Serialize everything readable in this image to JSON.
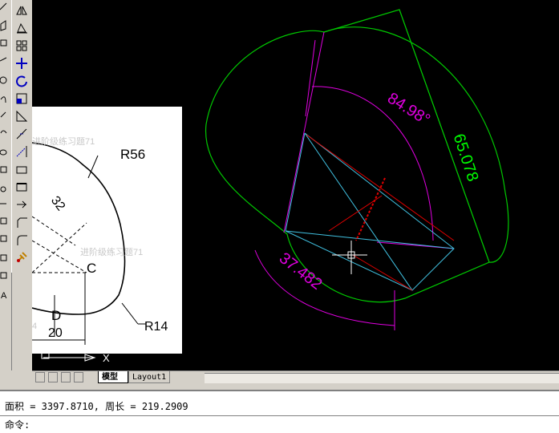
{
  "tabs": {
    "model": "模型",
    "layout1": "Layout1"
  },
  "command": {
    "history_line": "面积 = 3397.8710, 周长 = 219.2909",
    "prompt": "命令:"
  },
  "reference_image": {
    "watermark_top": "进阶级练习题71",
    "watermark_mid": "进阶级练习题71",
    "radius_large": "R56",
    "radius_small": "R14",
    "dim_32": "32",
    "dim_20": "20",
    "point_c": "C",
    "point_d": "D",
    "stray_digit": "4"
  },
  "drawing": {
    "dim_angle": "84.98°",
    "dim_aligned": "65.078",
    "dim_length": "37.482"
  },
  "ucs": {
    "x_label": "X"
  },
  "colors": {
    "canvas_bg": "#000000",
    "green_profile": "#00c800",
    "magenta_dim": "#e000e0",
    "dim_text_green": "#00ff00",
    "cyan_lines": "#40c0e0",
    "red_lines": "#e00000"
  },
  "icons": [
    "mirror-icon",
    "offset-icon",
    "array-icon",
    "move-icon",
    "rotate-icon",
    "scale-icon",
    "stretch-icon",
    "trim-icon",
    "extend-icon",
    "break-icon",
    "join-icon",
    "chamfer-icon",
    "fillet-icon",
    "explode-icon"
  ]
}
